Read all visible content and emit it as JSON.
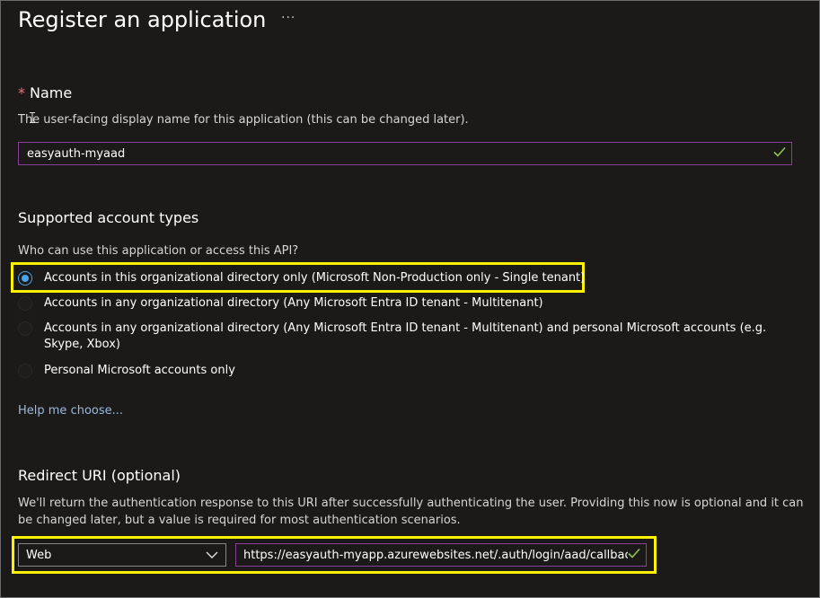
{
  "header": {
    "title": "Register an application",
    "more_label": "···"
  },
  "name_section": {
    "required_marker": "*",
    "heading": "Name",
    "description": "The user-facing display name for this application (this can be changed later).",
    "value": "easyauth-myaad"
  },
  "account_types": {
    "heading": "Supported account types",
    "question": "Who can use this application or access this API?",
    "options": [
      {
        "label": "Accounts in this organizational directory only (Microsoft Non-Production only - Single tenant)",
        "selected": true
      },
      {
        "label": "Accounts in any organizational directory (Any Microsoft Entra ID tenant - Multitenant)",
        "selected": false
      },
      {
        "label": "Accounts in any organizational directory (Any Microsoft Entra ID tenant - Multitenant) and personal Microsoft accounts (e.g. Skype, Xbox)",
        "selected": false
      },
      {
        "label": "Personal Microsoft accounts only",
        "selected": false
      }
    ],
    "help_link": "Help me choose..."
  },
  "redirect": {
    "heading": "Redirect URI (optional)",
    "description_line1": "We'll return the authentication response to this URI after successfully authenticating the user. Providing this now is optional and it can",
    "description_line2": "be changed later, but a value is required for most authentication scenarios.",
    "platform": "Web",
    "uri": "https://easyauth-myapp.azurewebsites.net/.auth/login/aad/callback"
  },
  "colors": {
    "background": "#1b1a19",
    "input_border": "#8a3f99",
    "radio_accent": "#4aa3ea",
    "highlight": "#fff200",
    "check": "#92c353",
    "link": "#9ab9e0"
  }
}
